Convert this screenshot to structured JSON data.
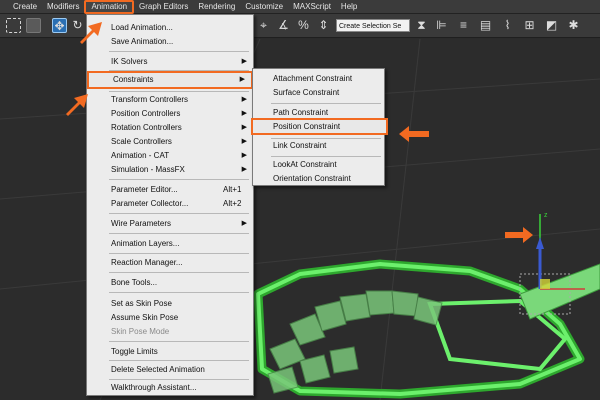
{
  "menubar": {
    "items": [
      "Create",
      "Modifiers",
      "Animation",
      "Graph Editors",
      "Rendering",
      "Customize",
      "MAXScript",
      "Help"
    ]
  },
  "toolbar": {
    "selection_set_placeholder": "Create Selection Se"
  },
  "animation_menu": {
    "load_animation": "Load Animation...",
    "save_animation": "Save Animation...",
    "ik_solvers": "IK Solvers",
    "constraints": "Constraints",
    "transform_controllers": "Transform Controllers",
    "position_controllers": "Position Controllers",
    "rotation_controllers": "Rotation Controllers",
    "scale_controllers": "Scale Controllers",
    "animation_cat": "Animation - CAT",
    "simulation_massfx": "Simulation - MassFX",
    "parameter_editor": "Parameter Editor...",
    "parameter_editor_shortcut": "Alt+1",
    "parameter_collector": "Parameter Collector...",
    "parameter_collector_shortcut": "Alt+2",
    "wire_parameters": "Wire Parameters",
    "animation_layers": "Animation Layers...",
    "reaction_manager": "Reaction Manager...",
    "bone_tools": "Bone Tools...",
    "set_as_skin_pose": "Set as Skin Pose",
    "assume_skin_pose": "Assume Skin Pose",
    "skin_pose_mode": "Skin Pose Mode",
    "toggle_limits": "Toggle Limits",
    "delete_selected_animation": "Delete Selected Animation",
    "walkthrough_assistant": "Walkthrough Assistant..."
  },
  "constraints_submenu": {
    "attachment": "Attachment Constraint",
    "surface": "Surface Constraint",
    "path": "Path Constraint",
    "position": "Position Constraint",
    "link": "Link Constraint",
    "lookat": "LookAt Constraint",
    "orientation": "Orientation Constraint"
  },
  "colors": {
    "highlight_orange": "#f26a21",
    "menu_bg": "#ececec",
    "ui_bg": "#3b3b3b",
    "object_green": "#5fe65f"
  },
  "icons": {
    "submenu_arrow": "▶"
  }
}
